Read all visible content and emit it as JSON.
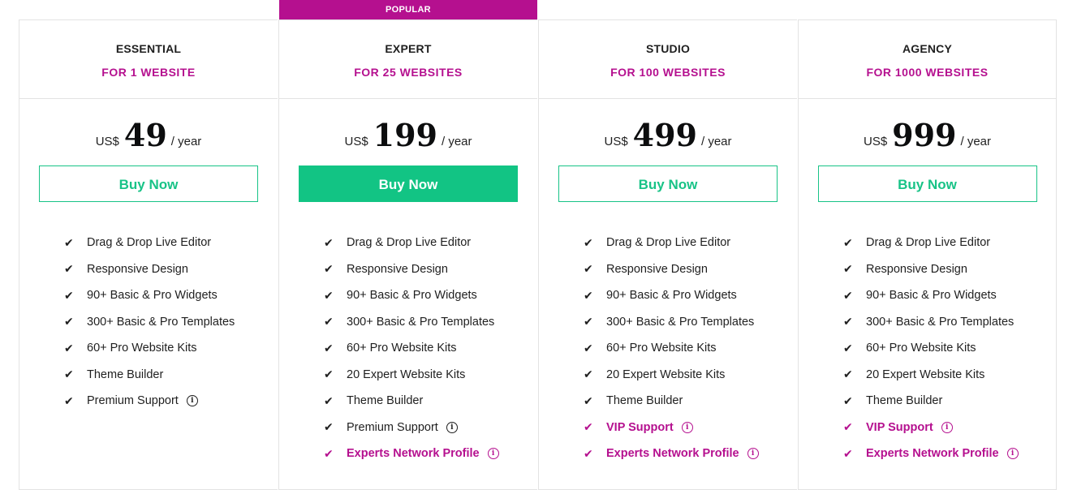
{
  "popular_label": "POPULAR",
  "currency": "US$",
  "period": "/ year",
  "colors": {
    "accent": "#b5108f",
    "green": "#12c484",
    "border": "#e3e3e3"
  },
  "icons": {
    "check": "check-icon",
    "info": "info-icon"
  },
  "plans": [
    {
      "name": "ESSENTIAL",
      "sub": "FOR 1 WEBSITE",
      "price": "49",
      "button": "Buy Now",
      "features": [
        {
          "text": "Drag & Drop Live Editor"
        },
        {
          "text": "Responsive Design"
        },
        {
          "text": "90+ Basic & Pro Widgets"
        },
        {
          "text": "300+ Basic & Pro Templates"
        },
        {
          "text": "60+ Pro Website Kits"
        },
        {
          "text": "Theme Builder"
        },
        {
          "text": "Premium Support",
          "info": true
        }
      ]
    },
    {
      "name": "EXPERT",
      "sub": "FOR 25 WEBSITES",
      "price": "199",
      "button": "Buy Now",
      "popular": true,
      "features": [
        {
          "text": "Drag & Drop Live Editor"
        },
        {
          "text": "Responsive Design"
        },
        {
          "text": "90+ Basic & Pro Widgets"
        },
        {
          "text": "300+ Basic & Pro Templates"
        },
        {
          "text": "60+ Pro Website Kits"
        },
        {
          "text": "20 Expert Website Kits"
        },
        {
          "text": "Theme Builder"
        },
        {
          "text": "Premium Support",
          "info": true
        },
        {
          "text": "Experts Network Profile",
          "info": true,
          "highlight": true
        }
      ]
    },
    {
      "name": "STUDIO",
      "sub": "FOR 100 WEBSITES",
      "price": "499",
      "button": "Buy Now",
      "features": [
        {
          "text": "Drag & Drop Live Editor"
        },
        {
          "text": "Responsive Design"
        },
        {
          "text": "90+ Basic & Pro Widgets"
        },
        {
          "text": "300+ Basic & Pro Templates"
        },
        {
          "text": "60+ Pro Website Kits"
        },
        {
          "text": "20 Expert Website Kits"
        },
        {
          "text": "Theme Builder"
        },
        {
          "text": "VIP Support",
          "info": true,
          "highlight": true
        },
        {
          "text": "Experts Network Profile",
          "info": true,
          "highlight": true
        }
      ]
    },
    {
      "name": "AGENCY",
      "sub": "FOR 1000 WEBSITES",
      "price": "999",
      "button": "Buy Now",
      "features": [
        {
          "text": "Drag & Drop Live Editor"
        },
        {
          "text": "Responsive Design"
        },
        {
          "text": "90+ Basic & Pro Widgets"
        },
        {
          "text": "300+ Basic & Pro Templates"
        },
        {
          "text": "60+ Pro Website Kits"
        },
        {
          "text": "20 Expert Website Kits"
        },
        {
          "text": "Theme Builder"
        },
        {
          "text": "VIP Support",
          "info": true,
          "highlight": true
        },
        {
          "text": "Experts Network Profile",
          "info": true,
          "highlight": true
        }
      ]
    }
  ]
}
